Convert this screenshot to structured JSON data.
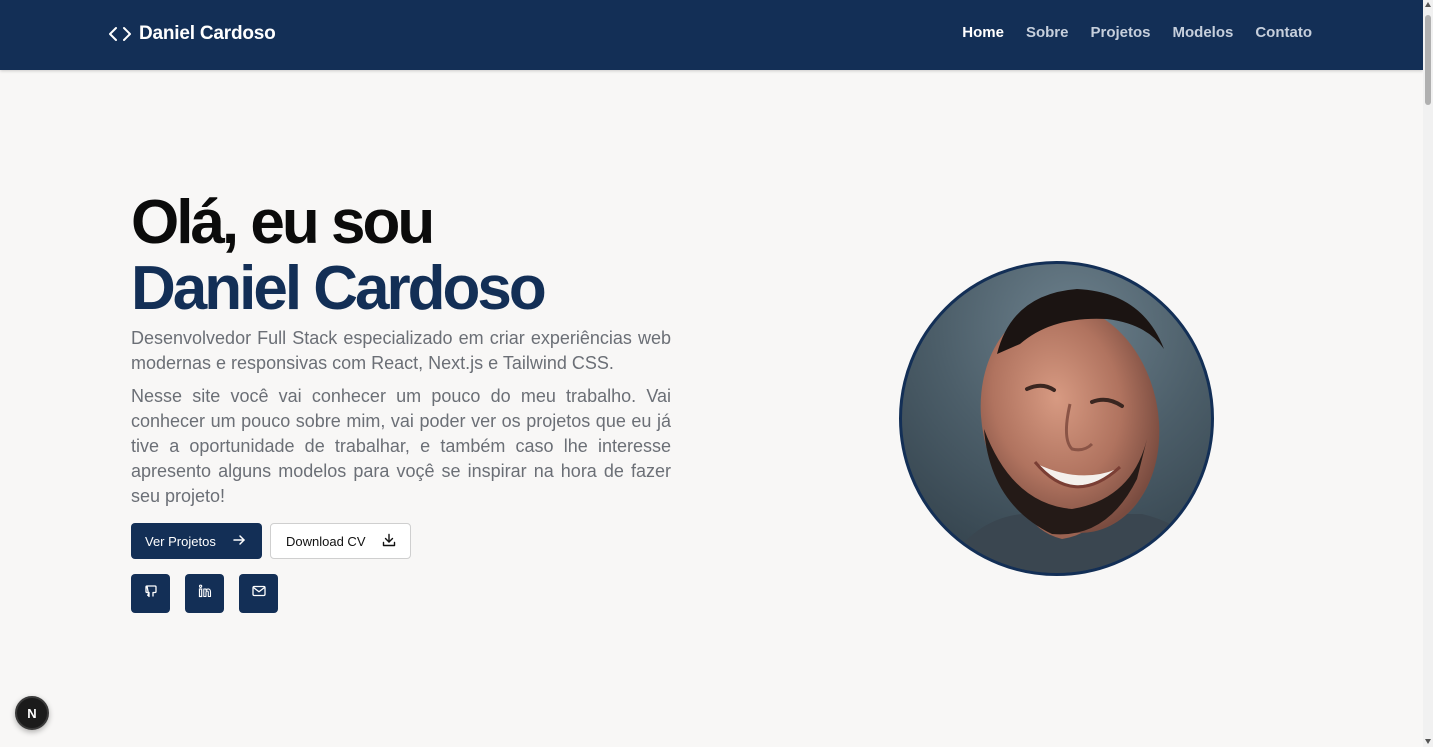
{
  "header": {
    "brand_icon": "code-brackets-icon",
    "brand_name": "Daniel Cardoso",
    "nav": [
      {
        "label": "Home",
        "active": true
      },
      {
        "label": "Sobre",
        "active": false
      },
      {
        "label": "Projetos",
        "active": false
      },
      {
        "label": "Modelos",
        "active": false
      },
      {
        "label": "Contato",
        "active": false
      }
    ]
  },
  "hero": {
    "greeting": "Olá, eu sou",
    "name": "Daniel Cardoso",
    "intro": "Desenvolvedor Full Stack especializado em criar experiências web modernas e responsivas com React, Next.js e Tailwind CSS.",
    "description": "Nesse site você vai conhecer um pouco do meu trabalho. Vai conhecer um pouco sobre mim, vai poder ver os projetos que eu já tive a oportunidade de trabalhar, e também caso lhe interesse apresento alguns modelos para voçê se inspirar na hora de fazer seu projeto!",
    "primary_button": {
      "label": "Ver Projetos",
      "icon": "arrow-right-icon"
    },
    "secondary_button": {
      "label": "Download CV",
      "icon": "download-icon"
    },
    "socials": [
      "github-icon",
      "linkedin-icon",
      "mail-icon"
    ]
  },
  "colors": {
    "brand_navy": "#132f56",
    "background": "#f8f7f6",
    "text_muted": "#6b6f76"
  },
  "dev_badge": "N"
}
